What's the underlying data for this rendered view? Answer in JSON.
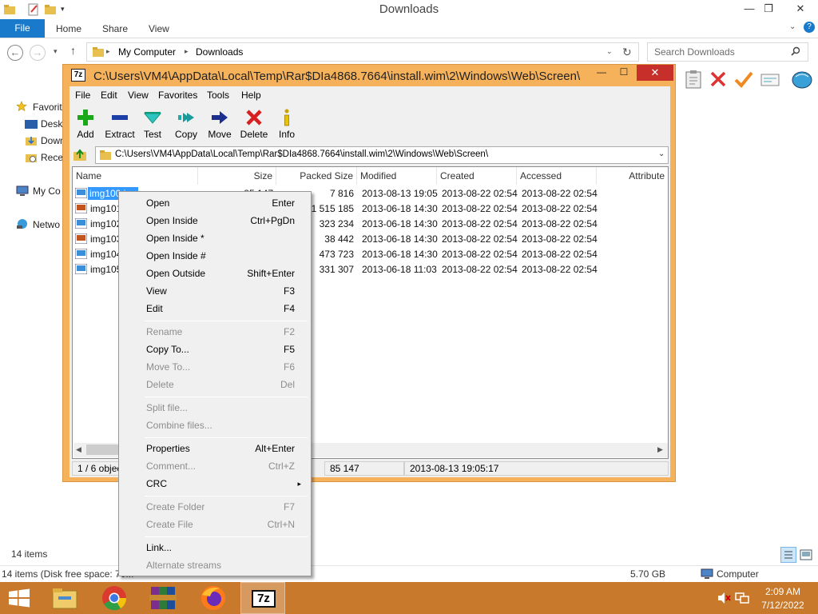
{
  "explorer": {
    "title": "Downloads",
    "ribbon_tabs": [
      "File",
      "Home",
      "Share",
      "View"
    ],
    "breadcrumb": [
      "My Computer",
      "Downloads"
    ],
    "search_placeholder": "Search Downloads",
    "nav": [
      "Favorit",
      "Deskt",
      "Down",
      "Rece",
      "My Co",
      "Netwo"
    ],
    "item_count": "14 items",
    "status_left": "14 items (Disk free space: 70...",
    "status_size": "5.70 GB",
    "status_computer": "Computer"
  },
  "sevenzip": {
    "title": "C:\\Users\\VM4\\AppData\\Local\\Temp\\Rar$DIa4868.7664\\install.wim\\2\\Windows\\Web\\Screen\\",
    "menu": [
      "File",
      "Edit",
      "View",
      "Favorites",
      "Tools",
      "Help"
    ],
    "toolbar": [
      "Add",
      "Extract",
      "Test",
      "Copy",
      "Move",
      "Delete",
      "Info"
    ],
    "path": "C:\\Users\\VM4\\AppData\\Local\\Temp\\Rar$DIa4868.7664\\install.wim\\2\\Windows\\Web\\Screen\\",
    "columns": [
      "Name",
      "Size",
      "Packed Size",
      "Modified",
      "Created",
      "Accessed",
      "Attribute"
    ],
    "rows": [
      {
        "name": "img100.jpg",
        "size": "85 147",
        "packed": "7 816",
        "modified": "2013-08-13 19:05",
        "created": "2013-08-22 02:54",
        "accessed": "2013-08-22 02:54"
      },
      {
        "name": "img101",
        "size": "",
        "packed": "1 515 185",
        "modified": "2013-06-18 14:30",
        "created": "2013-08-22 02:54",
        "accessed": "2013-08-22 02:54"
      },
      {
        "name": "img102",
        "size": "",
        "packed": "323 234",
        "modified": "2013-06-18 14:30",
        "created": "2013-08-22 02:54",
        "accessed": "2013-08-22 02:54"
      },
      {
        "name": "img103",
        "size": "",
        "packed": "38 442",
        "modified": "2013-06-18 14:30",
        "created": "2013-08-22 02:54",
        "accessed": "2013-08-22 02:54"
      },
      {
        "name": "img104",
        "size": "",
        "packed": "473 723",
        "modified": "2013-06-18 14:30",
        "created": "2013-08-22 02:54",
        "accessed": "2013-08-22 02:54"
      },
      {
        "name": "img105",
        "size": "",
        "packed": "331 307",
        "modified": "2013-06-18 11:03",
        "created": "2013-08-22 02:54",
        "accessed": "2013-08-22 02:54"
      }
    ],
    "status": [
      "1 / 6 object",
      "85 147",
      "2013-08-13 19:05:17"
    ]
  },
  "context_menu": [
    {
      "label": "Open",
      "key": "Enter"
    },
    {
      "label": "Open Inside",
      "key": "Ctrl+PgDn"
    },
    {
      "label": "Open Inside *",
      "key": ""
    },
    {
      "label": "Open Inside #",
      "key": ""
    },
    {
      "label": "Open Outside",
      "key": "Shift+Enter"
    },
    {
      "label": "View",
      "key": "F3"
    },
    {
      "label": "Edit",
      "key": "F4"
    },
    {
      "label": "Rename",
      "key": "F2"
    },
    {
      "label": "Copy To...",
      "key": "F5"
    },
    {
      "label": "Move To...",
      "key": "F6"
    },
    {
      "label": "Delete",
      "key": "Del"
    },
    {
      "label": "Split file...",
      "key": ""
    },
    {
      "label": "Combine files...",
      "key": ""
    },
    {
      "label": "Properties",
      "key": "Alt+Enter"
    },
    {
      "label": "Comment...",
      "key": "Ctrl+Z"
    },
    {
      "label": "CRC",
      "key": "▸"
    },
    {
      "label": "Create Folder",
      "key": "F7"
    },
    {
      "label": "Create File",
      "key": "Ctrl+N"
    },
    {
      "label": "Link...",
      "key": ""
    },
    {
      "label": "Alternate streams",
      "key": ""
    }
  ],
  "taskbar": {
    "apps": [
      "file-explorer",
      "chrome",
      "winrar",
      "firefox",
      "7-zip"
    ],
    "sevenzip_label": "7z",
    "time": "2:09 AM",
    "date": "7/12/2022"
  },
  "colors": {
    "accent": "#1979ca",
    "taskbar": "#c8792b",
    "sevenzip_frame": "#f6b25b",
    "selection": "#3399ff"
  }
}
